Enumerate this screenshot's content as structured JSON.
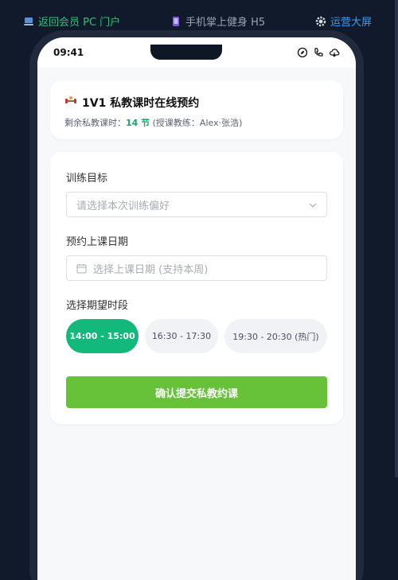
{
  "topnav": {
    "back_pc": "返回会员 PC 门户",
    "mobile_h5": "手机掌上健身 H5",
    "ops_screen": "运营大屏"
  },
  "statusbar": {
    "time": "09:41",
    "icons": [
      "compass-icon",
      "phone-icon",
      "cloud-icon"
    ]
  },
  "header": {
    "icon": "dumbbell-icon",
    "title": "1V1 私教课时在线预约",
    "remaining_label": "剩余私教课时：",
    "remaining_count": "14 节",
    "coach_info": "(授课教练：Alex·张浩)"
  },
  "form": {
    "goal_label": "训练目标",
    "goal_placeholder": "请选择本次训练偏好",
    "date_label": "预约上课日期",
    "date_placeholder": "选择上课日期 (支持本周)",
    "slot_label": "选择期望时段",
    "slots": [
      {
        "label": "14:00 - 15:00",
        "selected": true
      },
      {
        "label": "16:30 - 17:30",
        "selected": false
      },
      {
        "label": "19:30 - 20:30 (热门)",
        "selected": false
      }
    ],
    "submit_label": "确认提交私教约课"
  },
  "colors": {
    "accent_green": "#13b97b",
    "submit_green": "#67c23a",
    "link_blue": "#3b9cf5",
    "bg_dark": "#111a2b"
  }
}
